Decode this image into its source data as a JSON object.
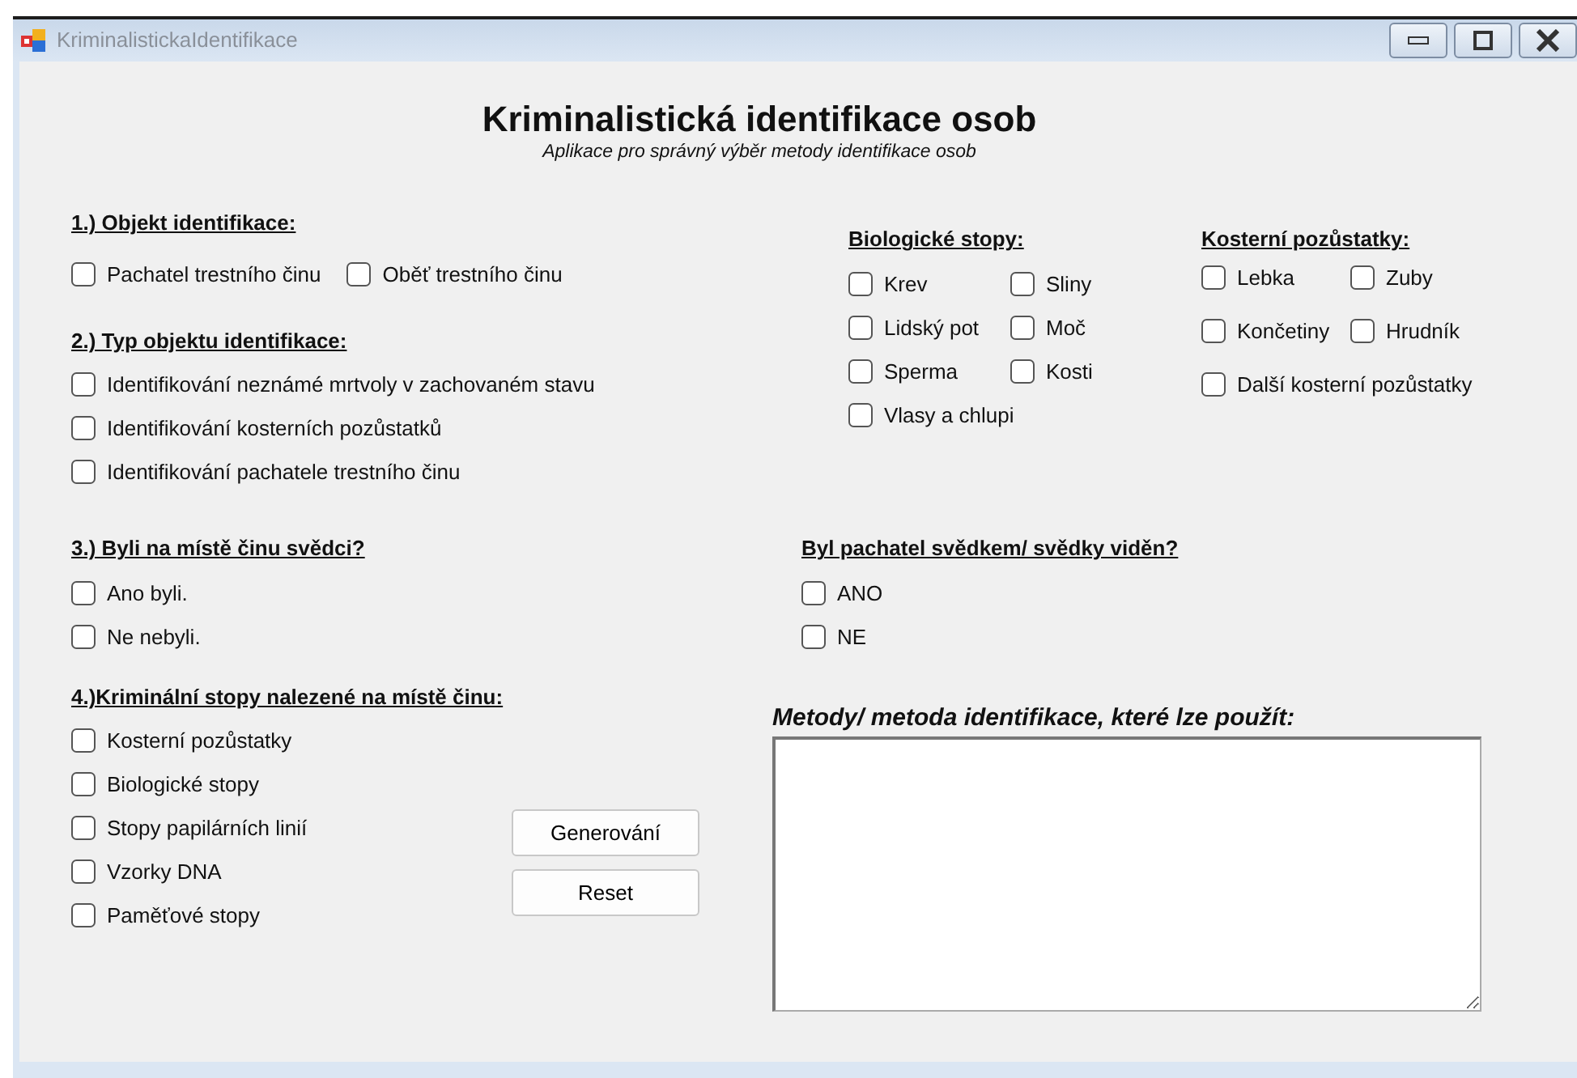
{
  "window": {
    "title": "KriminalistickaIdentifikace"
  },
  "heading": {
    "title": "Kriminalistická identifikace osob",
    "subtitle": "Aplikace pro správný výběr metody identifikace osob"
  },
  "objekt": {
    "label": "1.) Objekt identifikace:",
    "options": [
      {
        "label": "Pachatel trestního činu",
        "checked": false
      },
      {
        "label": "Oběť trestního činu",
        "checked": false
      }
    ]
  },
  "typ": {
    "label": "2.) Typ objektu identifikace:",
    "options": [
      {
        "label": "Identifikování neznámé mrtvoly v zachovaném stavu",
        "checked": false
      },
      {
        "label": "Identifikování kosterních pozůstatků",
        "checked": false
      },
      {
        "label": "Identifikování pachatele trestního činu",
        "checked": false
      }
    ]
  },
  "biologicke": {
    "label": "Biologické stopy:",
    "options": [
      {
        "label": "Krev",
        "checked": false
      },
      {
        "label": "Sliny",
        "checked": false
      },
      {
        "label": "Lidský pot",
        "checked": false
      },
      {
        "label": "Moč",
        "checked": false
      },
      {
        "label": "Sperma",
        "checked": false
      },
      {
        "label": "Kosti",
        "checked": false
      },
      {
        "label": "Vlasy a chlupi",
        "checked": false
      }
    ]
  },
  "kosterni": {
    "label": "Kosterní pozůstatky:",
    "options": [
      {
        "label": "Lebka",
        "checked": false
      },
      {
        "label": "Zuby",
        "checked": false
      },
      {
        "label": "Končetiny",
        "checked": false
      },
      {
        "label": "Hrudník",
        "checked": false
      },
      {
        "label": "Další kosterní pozůstatky",
        "checked": false
      }
    ]
  },
  "svedci": {
    "label": "3.) Byli na místě činu svědci?",
    "options": [
      {
        "label": "Ano byli.",
        "checked": false
      },
      {
        "label": "Ne nebyli.",
        "checked": false
      }
    ]
  },
  "pachatel_viden": {
    "label": "Byl pachatel svědkem/ svědky viděn?",
    "options": [
      {
        "label": "ANO",
        "checked": false
      },
      {
        "label": "NE",
        "checked": false
      }
    ]
  },
  "stopy": {
    "label": "4.)Kriminální stopy nalezené na místě činu:",
    "options": [
      {
        "label": "Kosterní pozůstatky",
        "checked": false
      },
      {
        "label": "Biologické stopy",
        "checked": false
      },
      {
        "label": "Stopy papilárních linií",
        "checked": false
      },
      {
        "label": "Vzorky DNA",
        "checked": false
      },
      {
        "label": "Paměťové stopy",
        "checked": false
      }
    ]
  },
  "buttons": [
    {
      "label": "Generování"
    },
    {
      "label": "Reset"
    }
  ],
  "metody": {
    "label": "Metody/ metoda identifikace, které lze použít:"
  }
}
